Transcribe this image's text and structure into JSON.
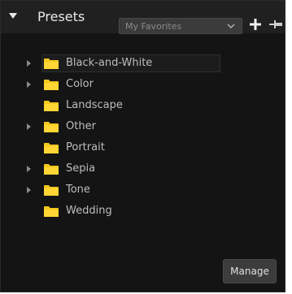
{
  "panel": {
    "title": "Presets",
    "dropdown_value": "My Favorites"
  },
  "tree": {
    "items": [
      {
        "label": "Black-and-White",
        "expandable": true,
        "selected": true
      },
      {
        "label": "Color",
        "expandable": true,
        "selected": false
      },
      {
        "label": "Landscape",
        "expandable": false,
        "selected": false
      },
      {
        "label": "Other",
        "expandable": true,
        "selected": false
      },
      {
        "label": "Portrait",
        "expandable": false,
        "selected": false
      },
      {
        "label": "Sepia",
        "expandable": true,
        "selected": false
      },
      {
        "label": "Tone",
        "expandable": true,
        "selected": false
      },
      {
        "label": "Wedding",
        "expandable": false,
        "selected": false
      }
    ]
  },
  "footer": {
    "manage_label": "Manage"
  },
  "colors": {
    "folder": "#f2c81d",
    "background": "#141414",
    "header": "#202020"
  },
  "icons": {
    "collapse": "triangle-down-icon",
    "add": "plus-icon",
    "pin": "pin-icon",
    "folder": "folder-icon",
    "expander": "triangle-right-icon"
  }
}
